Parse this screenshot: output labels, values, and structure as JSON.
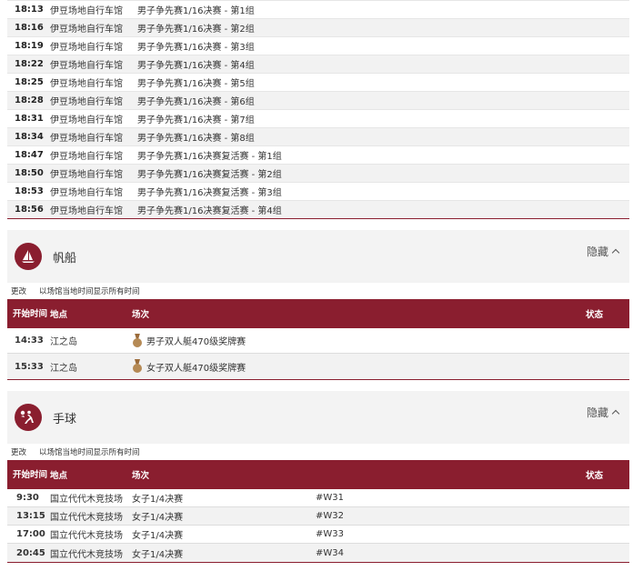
{
  "cycling_rows": [
    {
      "time": "18:13",
      "venue": "伊豆场地自行车馆",
      "event": "男子争先赛1/16决赛 - 第1组"
    },
    {
      "time": "18:16",
      "venue": "伊豆场地自行车馆",
      "event": "男子争先赛1/16决赛 - 第2组"
    },
    {
      "time": "18:19",
      "venue": "伊豆场地自行车馆",
      "event": "男子争先赛1/16决赛 - 第3组"
    },
    {
      "time": "18:22",
      "venue": "伊豆场地自行车馆",
      "event": "男子争先赛1/16决赛 - 第4组"
    },
    {
      "time": "18:25",
      "venue": "伊豆场地自行车馆",
      "event": "男子争先赛1/16决赛 - 第5组"
    },
    {
      "time": "18:28",
      "venue": "伊豆场地自行车馆",
      "event": "男子争先赛1/16决赛 - 第6组"
    },
    {
      "time": "18:31",
      "venue": "伊豆场地自行车馆",
      "event": "男子争先赛1/16决赛 - 第7组"
    },
    {
      "time": "18:34",
      "venue": "伊豆场地自行车馆",
      "event": "男子争先赛1/16决赛 - 第8组"
    },
    {
      "time": "18:47",
      "venue": "伊豆场地自行车馆",
      "event": "男子争先赛1/16决赛复活赛 - 第1组"
    },
    {
      "time": "18:50",
      "venue": "伊豆场地自行车馆",
      "event": "男子争先赛1/16决赛复活赛 - 第2组"
    },
    {
      "time": "18:53",
      "venue": "伊豆场地自行车馆",
      "event": "男子争先赛1/16决赛复活赛 - 第3组"
    },
    {
      "time": "18:56",
      "venue": "伊豆场地自行车馆",
      "event": "男子争先赛1/16决赛复活赛 - 第4组"
    }
  ],
  "common": {
    "hide_label": "隐藏",
    "change_label": "更改",
    "timezone_note": "以场馆当地时间显示所有时间",
    "col_time": "开始时间",
    "col_venue": "地点",
    "col_event": "场次",
    "col_status": "状态"
  },
  "sailing": {
    "name": "帆船",
    "icon": "sailboat-icon",
    "rows": [
      {
        "time": "14:33",
        "venue": "江之岛",
        "event": "男子双人艇470级奖牌赛",
        "medal": "medal-icon"
      },
      {
        "time": "15:33",
        "venue": "江之岛",
        "event": "女子双人艇470级奖牌赛",
        "medal": "medal-icon"
      }
    ]
  },
  "handball": {
    "name": "手球",
    "icon": "handball-icon",
    "rows": [
      {
        "time": "9:30",
        "venue": "国立代代木竞技场",
        "event": "女子1/4决赛",
        "code": "#W31"
      },
      {
        "time": "13:15",
        "venue": "国立代代木竞技场",
        "event": "女子1/4决赛",
        "code": "#W32"
      },
      {
        "time": "17:00",
        "venue": "国立代代木竞技场",
        "event": "女子1/4决赛",
        "code": "#W33"
      },
      {
        "time": "20:45",
        "venue": "国立代代木竞技场",
        "event": "女子1/4决赛",
        "code": "#W34"
      }
    ]
  },
  "colors": {
    "accent": "#8a1e2f",
    "row_alt": "#f2f2f2",
    "section_bg": "#f3f3f3"
  }
}
